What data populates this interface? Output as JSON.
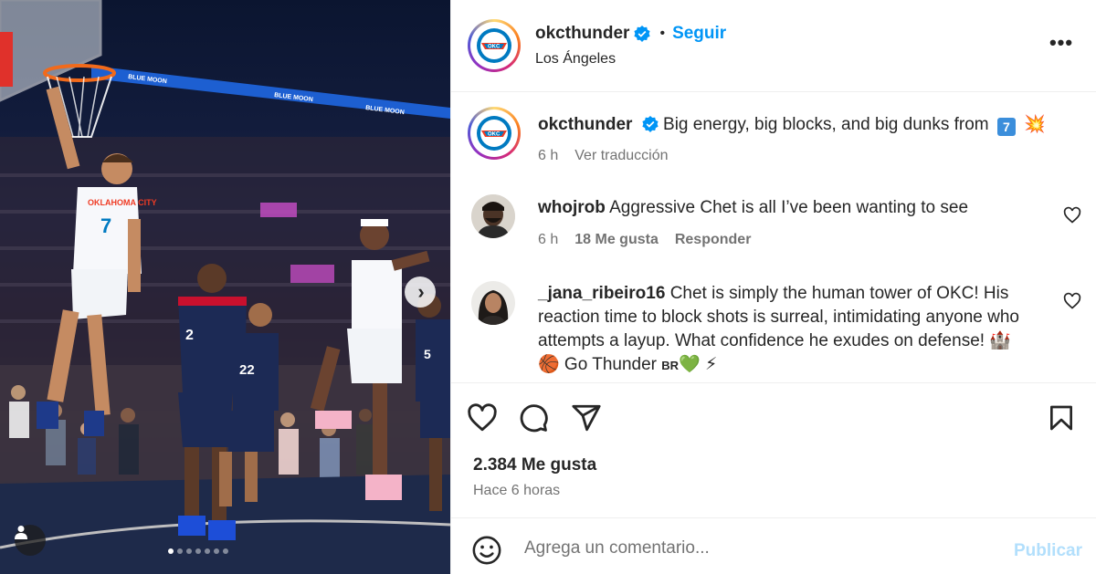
{
  "media": {
    "image_alt": "Basketball game action photo",
    "carousel_total": 7,
    "carousel_active": 1,
    "jersey_numbers": [
      "7",
      "2",
      "22",
      "5"
    ],
    "jersey_wordmark": "OKLAHOMA CITY",
    "arena_sign": "BLUE MOON"
  },
  "header": {
    "username": "okcthunder",
    "separator": "•",
    "follow_label": "Seguir",
    "location": "Los Ángeles",
    "more_label": "•••"
  },
  "caption": {
    "username": "okcthunder",
    "text": "Big energy, big blocks, and big dunks from",
    "emoji_number": "7",
    "emoji_tail": "💥",
    "time": "6 h",
    "translate_label": "Ver traducción"
  },
  "comments": [
    {
      "username": "whojrob",
      "text": "Aggressive Chet is all I’ve been wanting to see",
      "time": "6 h",
      "likes": "18 Me gusta",
      "reply_label": "Responder"
    },
    {
      "username": "_jana_ribeiro16",
      "text": "Chet is simply the human tower of OKC! His reaction time to block shots is surreal, intimidating anyone who attempts a layup. What confidence he exudes on defense! 🏰",
      "text2": "🏀 Go Thunder",
      "flag": "BR",
      "text2_tail": "💚 ⚡"
    }
  ],
  "actions": {
    "like_count": "2.384 Me gusta",
    "time_ago": "Hace 6 horas"
  },
  "composer": {
    "placeholder": "Agrega un comentario...",
    "publish_label": "Publicar"
  },
  "colors": {
    "accent": "#0095f6",
    "publish_disabled": "#b2dffc",
    "secondary_text": "#737373",
    "thunder_blue": "#007ac1",
    "thunder_orange": "#ef3b24"
  }
}
